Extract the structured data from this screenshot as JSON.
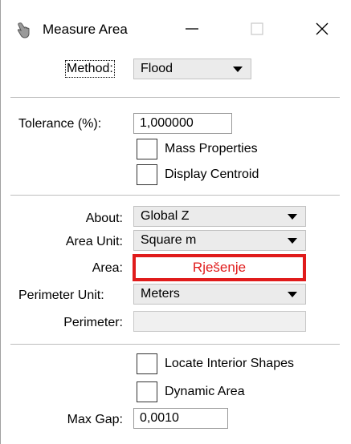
{
  "window": {
    "title": "Measure Area",
    "icon": "hand-cursor-icon",
    "controls": [
      "minimize-icon",
      "maximize-icon",
      "close-icon"
    ]
  },
  "method": {
    "label": "Method:",
    "value": "Flood"
  },
  "tolerance": {
    "label": "Tolerance (%):",
    "value": "1,000000"
  },
  "options": {
    "mass_properties": {
      "label": "Mass Properties",
      "checked": false
    },
    "display_centroid": {
      "label": "Display Centroid",
      "checked": false
    }
  },
  "about": {
    "label": "About:",
    "value": "Global Z"
  },
  "area_unit": {
    "label": "Area Unit:",
    "value": "Square m"
  },
  "area": {
    "label": "Area:",
    "value": "Rješenje"
  },
  "perimeter_unit": {
    "label": "Perimeter Unit:",
    "value": "Meters"
  },
  "perimeter": {
    "label": "Perimeter:",
    "value": ""
  },
  "locate_interior": {
    "label": "Locate Interior Shapes",
    "checked": false
  },
  "dynamic_area": {
    "label": "Dynamic Area",
    "checked": false
  },
  "max_gap": {
    "label": "Max Gap:",
    "value": "0,0010"
  },
  "colors": {
    "highlight": "#e01b1b",
    "combo_bg": "#ebebeb"
  }
}
